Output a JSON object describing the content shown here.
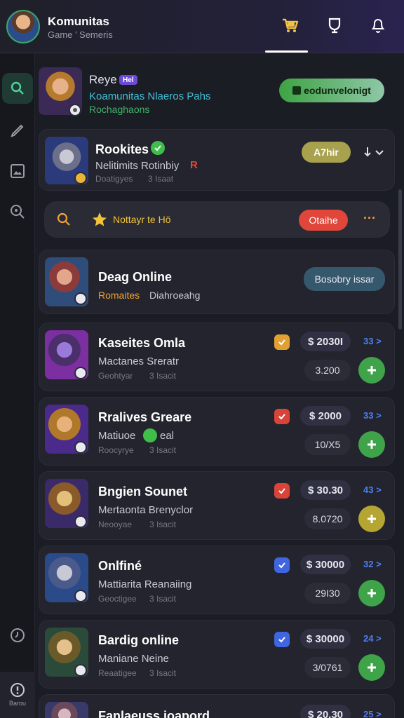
{
  "header": {
    "title": "Komunitas",
    "subtitle": "Game  ’ Semeris",
    "icons": [
      "cart-icon",
      "trophy-icon",
      "bell-icon"
    ]
  },
  "sidebar": {
    "icons": [
      "search-icon",
      "edit-icon",
      "image-icon",
      "zoom-icon",
      "clock-icon",
      "info-icon"
    ],
    "bottom_label": "Barou"
  },
  "profile": {
    "name": "Reye",
    "tag": "Hel",
    "line1": "Koamunitas Nlaeros Pahs",
    "line2": "Rochaghaons",
    "action_label": "eodunvelonigt"
  },
  "featured": {
    "title": "Rookites",
    "line": "Nelitimits Rotinbiy",
    "tag_letter": "R",
    "meta1": "Doatigyes",
    "meta2": "3 Isaat",
    "pill_label": "A7hir"
  },
  "search_bar": {
    "label": "Nottayr te Hö",
    "button_label": "Otaihe",
    "more": "···"
  },
  "online_card": {
    "title": "Deag Online",
    "tag": "Romaites",
    "line": "Diahroeahg",
    "button_label": "Bosobry issar"
  },
  "items": [
    {
      "title": "Kaseites Omla",
      "line": "Mactanes Sreratr",
      "meta1": "Geohtyar",
      "meta2": "3 Isacit",
      "price": "$ 2030I",
      "count": "33 >",
      "sub": "3.200",
      "accent": "#e2a033",
      "plus_color": "#3fa34a"
    },
    {
      "title": "Rralives Greare",
      "line": "Matiuoe",
      "line_b": "eal",
      "meta1": "Roocyrye",
      "meta2": "3 Isacit",
      "price": "$ 2000",
      "count": "33 >",
      "sub": "10/X5",
      "accent": "#d8433a",
      "plus_color": "#3fa34a"
    },
    {
      "title": "Bngien Sounet",
      "line": "Mertaonta Brenyclor",
      "meta1": "Neooyae",
      "meta2": "3 Isacit",
      "price": "$ 30.30",
      "count": "43 >",
      "sub": "8.0720",
      "accent": "#d8433a",
      "plus_color": "#b5a532"
    },
    {
      "title": "Onlfiné",
      "line": "Mattiarita Reanaiing",
      "meta1": "Geoctigee",
      "meta2": "3 Isacit",
      "price": "$ 30000",
      "count": "32 >",
      "sub": "29I30",
      "accent": "#3f66e0",
      "plus_color": "#3fa34a"
    },
    {
      "title": "Bardig online",
      "line": "Maniane  Neine",
      "meta1": "Reaatigee",
      "meta2": "3 Isacit",
      "price": "$ 30000",
      "count": "24 >",
      "sub": "3/0761",
      "accent": "#3f66e0",
      "plus_color": "#3fa34a"
    },
    {
      "title": "Fanlaeuss ioapord",
      "price": "$ 20.30",
      "count": "25 >"
    }
  ],
  "colors": {
    "background": "#1b1d24",
    "card": "#23242d",
    "accent_green": "#3fa34a",
    "accent_blue": "#4f7ff2",
    "accent_red": "#e0473a"
  }
}
